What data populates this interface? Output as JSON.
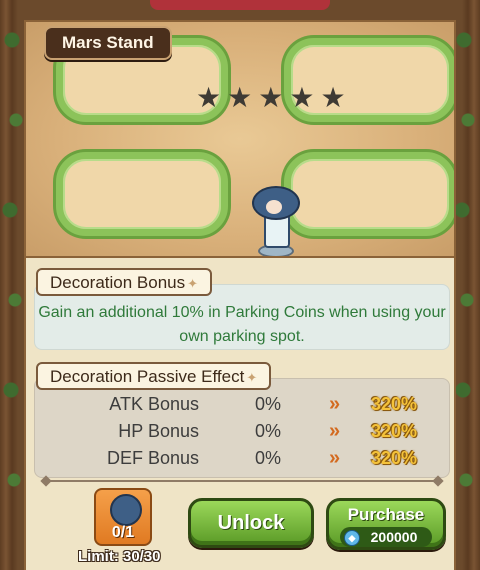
{
  "title": "Mars Stand",
  "stars": {
    "filled": 0,
    "total": 5,
    "icon": "star-icon",
    "color": "#3e3a34"
  },
  "decoration_bonus": {
    "heading": "Decoration Bonus",
    "text": "Gain an additional 10% in Parking Coins when using your own parking spot."
  },
  "passive_effect": {
    "heading": "Decoration Passive Effect",
    "stats": [
      {
        "name": "ATK Bonus",
        "from": "0%",
        "to": "320%"
      },
      {
        "name": "HP Bonus",
        "from": "0%",
        "to": "320%"
      },
      {
        "name": "DEF Bonus",
        "from": "0%",
        "to": "320%"
      }
    ],
    "arrow": "»"
  },
  "item": {
    "count": "0/1",
    "limit": "Limit: 30/30"
  },
  "buttons": {
    "unlock": "Unlock",
    "purchase": "Purchase",
    "price": "200000",
    "price_icon": "gem-coin-icon"
  },
  "colors": {
    "accent_green": "#2f7a3a",
    "value_gold": "#f4c23a",
    "arrow_orange": "#d36a1f"
  }
}
